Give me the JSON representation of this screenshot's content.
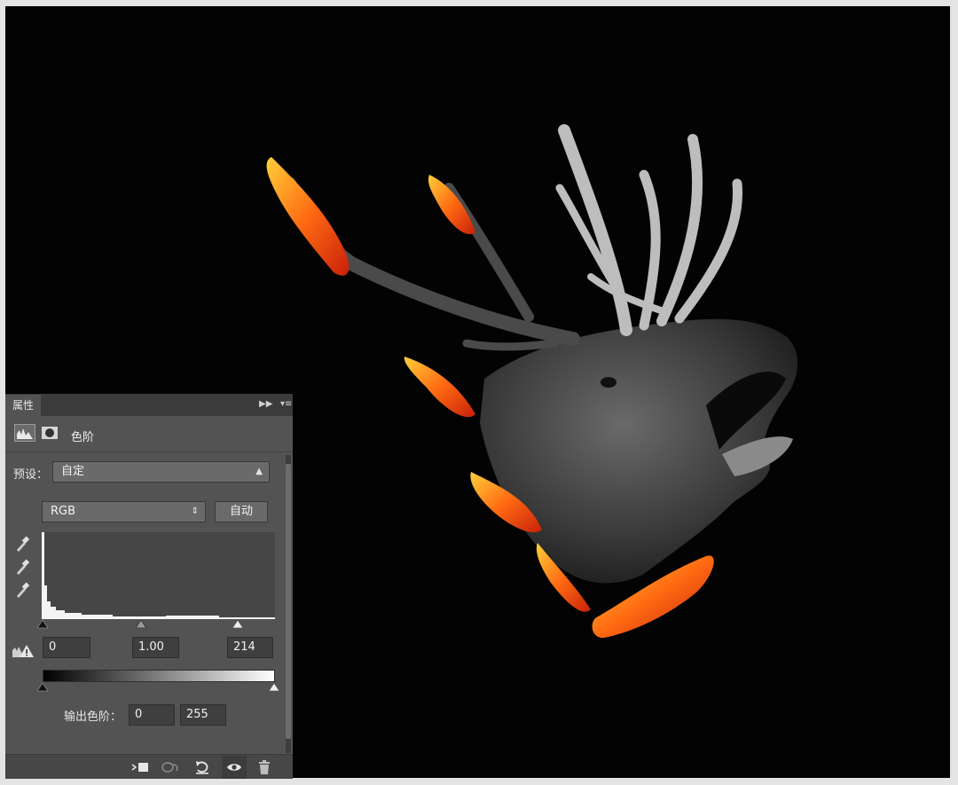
{
  "panel": {
    "tab_label": "属性",
    "header_title": "色阶",
    "preset_label": "预设：",
    "preset_value": "自定",
    "channel_value": "RGB",
    "auto_button": "自动",
    "input_black": "0",
    "input_gamma": "1.00",
    "input_white": "214",
    "output_label": "输出色阶：",
    "output_black": "0",
    "output_white": "255"
  },
  "icons": {
    "collapse": "double-chevron-right-icon",
    "menu": "panel-menu-icon",
    "levels": "levels-icon",
    "mask": "layer-mask-icon",
    "eyedropper_black": "eyedropper-black-icon",
    "eyedropper_gray": "eyedropper-gray-icon",
    "eyedropper_white": "eyedropper-white-icon",
    "clipping": "clipping-warning-icon",
    "clip_to_layer": "clip-to-layer-icon",
    "view_previous": "view-previous-state-icon",
    "reset": "reset-icon",
    "visibility": "eye-icon",
    "delete": "trash-icon"
  },
  "colors": {
    "panel_bg": "#535353",
    "canvas_bg": "#030303",
    "fire": "#ff5a14"
  }
}
